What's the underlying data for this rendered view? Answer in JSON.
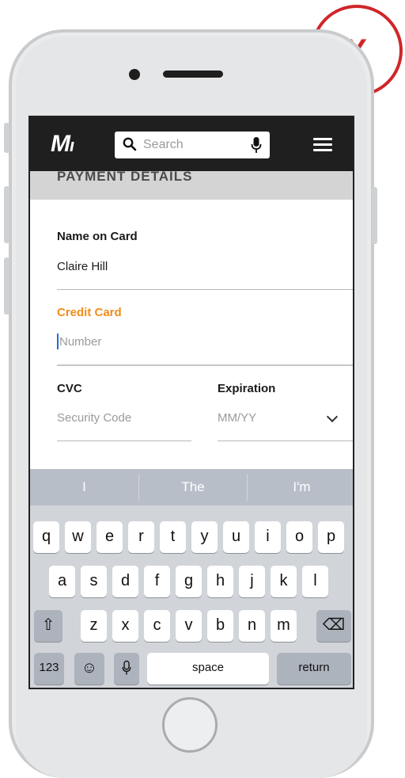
{
  "badge": {
    "symbol": "X"
  },
  "header": {
    "logo_text": "M",
    "search_placeholder": "Search"
  },
  "section": {
    "title": "PAYMENT DETAILS"
  },
  "form": {
    "name_label": "Name on Card",
    "name_value": "Claire Hill",
    "card_label": "Credit Card",
    "card_placeholder": "Number",
    "cvc_label": "CVC",
    "cvc_placeholder": "Security  Code",
    "exp_label": "Expiration",
    "exp_placeholder": "MM/YY"
  },
  "colors": {
    "active_label": "#f28c1b",
    "badge": "#d0262a"
  },
  "keyboard": {
    "suggestions": [
      "I",
      "The",
      "I'm"
    ],
    "row1": [
      "q",
      "w",
      "e",
      "r",
      "t",
      "y",
      "u",
      "i",
      "o",
      "p"
    ],
    "row2": [
      "a",
      "s",
      "d",
      "f",
      "g",
      "h",
      "j",
      "k",
      "l"
    ],
    "row3": [
      "z",
      "x",
      "c",
      "v",
      "b",
      "n",
      "m"
    ],
    "numbers_label": "123",
    "space_label": "space",
    "return_label": "return",
    "shift_glyph": "⇧",
    "emoji_glyph": "☺",
    "delete_glyph": "⌫"
  }
}
